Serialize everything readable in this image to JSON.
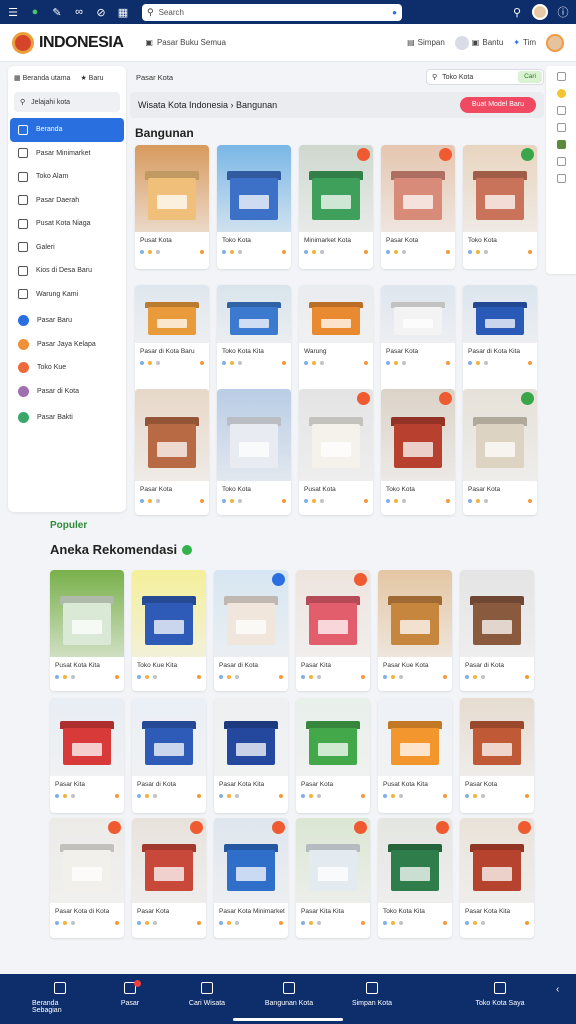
{
  "topbar": {
    "search_placeholder": "Search",
    "icons": [
      "menu-icon",
      "app-logo-icon",
      "edit-icon",
      "link-icon",
      "block-icon",
      "id-card-icon",
      "search-icon",
      "user-icon",
      "help-icon"
    ]
  },
  "header": {
    "brand": "INDONESIA",
    "nav_link": "Pasar Buku Semua",
    "items": [
      "Simpan",
      "Bantu",
      "Tim"
    ]
  },
  "sidebar": {
    "top_links": [
      "Beranda utama",
      "Baru"
    ],
    "search_label": "Jelajahi kota",
    "items": [
      {
        "label": "Beranda",
        "active": true,
        "kind": "icon"
      },
      {
        "label": "Pasar Minimarket",
        "active": false,
        "kind": "icon"
      },
      {
        "label": "Toko Alam",
        "active": false,
        "kind": "icon"
      },
      {
        "label": "Pasar Daerah",
        "active": false,
        "kind": "icon"
      },
      {
        "label": "Pusat Kota Niaga",
        "active": false,
        "kind": "icon"
      },
      {
        "label": "Galeri",
        "active": false,
        "kind": "icon"
      },
      {
        "label": "Kios di Desa Baru",
        "active": false,
        "kind": "icon"
      },
      {
        "label": "Warung Kami",
        "active": false,
        "kind": "icon"
      },
      {
        "label": "Pasar Baru",
        "active": false,
        "kind": "dot",
        "color": "#2a6fe0"
      },
      {
        "label": "Pasar Jaya Kelapa",
        "active": false,
        "kind": "dot",
        "color": "#f0913a"
      },
      {
        "label": "Toko Kue",
        "active": false,
        "kind": "dot",
        "color": "#ee6a3a"
      },
      {
        "label": "Pasar di Kota",
        "active": false,
        "kind": "dot",
        "color": "#a070b0"
      },
      {
        "label": "Pasar Bakti",
        "active": false,
        "kind": "dot",
        "color": "#3aa66a"
      }
    ]
  },
  "main": {
    "category_label": "Pasar Kota",
    "mini_search_placeholder": "Toko Kota",
    "mini_search_button": "Cari",
    "banner_text": "Wisata Kota Indonesia › Bangunan",
    "banner_cta": "Buat Model Baru",
    "section_title": "Bangunan"
  },
  "section1_cards": [
    {
      "title": "Pusat Kota",
      "bg": "#d89a5e",
      "bldg": "#f0c07a",
      "badge": ""
    },
    {
      "title": "Toko Kota",
      "bg": "#7ab7e6",
      "bldg": "#3d70c7",
      "badge": ""
    },
    {
      "title": "Minimarket Kota",
      "bg": "#cfd8cf",
      "bldg": "#3ea05a",
      "badge": "#ef5a30"
    },
    {
      "title": "Pasar Kota",
      "bg": "#e5c6b0",
      "bldg": "#d98b7a",
      "badge": "#ef5a30"
    },
    {
      "title": "Toko Kota",
      "bg": "#e8d5c0",
      "bldg": "#c9745a",
      "badge": "#3aa64a"
    },
    {
      "title": "Pasar di Kota Baru",
      "bg": "#dfe7ee",
      "bldg": "#e99a3a",
      "badge": ""
    },
    {
      "title": "Toko Kota Kita",
      "bg": "#d8e4ec",
      "bldg": "#3c7ad0",
      "badge": ""
    },
    {
      "title": "Warung",
      "bg": "#e9ecef",
      "bldg": "#e98a30",
      "badge": ""
    },
    {
      "title": "Pasar Kota",
      "bg": "#dfe6ef",
      "bldg": "#f3f3f3",
      "badge": ""
    },
    {
      "title": "Pasar di Kota Kita",
      "bg": "#dce5ee",
      "bldg": "#2a5ab8",
      "badge": ""
    },
    {
      "title": "Pasar Kota",
      "bg": "#e7d8c8",
      "bldg": "#b86a44",
      "badge": ""
    },
    {
      "title": "Toko Kota",
      "bg": "#b9cde6",
      "bldg": "#e8ecf2",
      "badge": ""
    },
    {
      "title": "Pusat Kota",
      "bg": "#e4e4e4",
      "bldg": "#f5f2ec",
      "badge": "#ef5a30"
    },
    {
      "title": "Toko Kota",
      "bg": "#dcd3c8",
      "bldg": "#b8402e",
      "badge": "#ef5a30"
    },
    {
      "title": "Pasar Kota",
      "bg": "#e6e1d8",
      "bldg": "#ddd3c2",
      "badge": "#3aa64a"
    }
  ],
  "section2": {
    "small_title": "Populer",
    "title": "Aneka Rekomendasi"
  },
  "section2_cards": [
    {
      "title": "Pusat Kota Kita",
      "bg": "#78b04a",
      "bldg": "#d9e9d5",
      "badge": ""
    },
    {
      "title": "Toko Kue Kita",
      "bg": "#f4ef9a",
      "bldg": "#2f5bb8",
      "badge": ""
    },
    {
      "title": "Pasar di Kota",
      "bg": "#d6e6f2",
      "bldg": "#f0e6dc",
      "badge": "#2a6fe0"
    },
    {
      "title": "Pasar Kita",
      "bg": "#eee4de",
      "bldg": "#e25e6c",
      "badge": "#ef5a30"
    },
    {
      "title": "Pasar Kue Kota",
      "bg": "#e4c6a4",
      "bldg": "#c7863e",
      "badge": ""
    },
    {
      "title": "Pasar di Kota",
      "bg": "#e4e4e4",
      "bldg": "#8a5a3e",
      "badge": ""
    },
    {
      "title": "Pasar Kita",
      "bg": "#e8eef4",
      "bldg": "#d83a3a",
      "badge": ""
    },
    {
      "title": "Pasar di Kota",
      "bg": "#eaf0f6",
      "bldg": "#2f5bb8",
      "badge": ""
    },
    {
      "title": "Pasar Kota Kita",
      "bg": "#eef0f2",
      "bldg": "#24489e",
      "badge": ""
    },
    {
      "title": "Pasar Kota",
      "bg": "#e8f0ea",
      "bldg": "#43a84a",
      "badge": ""
    },
    {
      "title": "Pusat Kota Kita",
      "bg": "#eef2f6",
      "bldg": "#f3962e",
      "badge": ""
    },
    {
      "title": "Pasar Kota",
      "bg": "#e6dcd0",
      "bldg": "#c05a36",
      "badge": ""
    },
    {
      "title": "Pasar Kota di Kota",
      "bg": "#ecebe8",
      "bldg": "#f2f0ea",
      "badge": "#ef5a30"
    },
    {
      "title": "Pasar Kota",
      "bg": "#e8e2dc",
      "bldg": "#c8493a",
      "badge": "#ef5a30"
    },
    {
      "title": "Pasar Kota Minimarket",
      "bg": "#dfe6ee",
      "bldg": "#2f6ec9",
      "badge": "#ef5a30"
    },
    {
      "title": "Pasar Kita Kita",
      "bg": "#dbe6d3",
      "bldg": "#e3eaf0",
      "badge": "#ef5a30"
    },
    {
      "title": "Toko Kota Kita",
      "bg": "#e4e6e2",
      "bldg": "#2e7d4a",
      "badge": "#ef5a30"
    },
    {
      "title": "Pasar Kota Kita",
      "bg": "#e9e2d9",
      "bldg": "#b5432e",
      "badge": "#ef5a30"
    }
  ],
  "bottom_nav": [
    {
      "label": "Beranda Sebagian",
      "icon": "store-icon"
    },
    {
      "label": "Pasar",
      "icon": "home-icon"
    },
    {
      "label": "Cari Wisata",
      "icon": "box-icon"
    },
    {
      "label": "Bangunan Kota",
      "icon": "map-icon"
    },
    {
      "label": "Simpan Kota",
      "icon": "folder-icon"
    },
    {
      "label": "Toko Kota Saya",
      "icon": "profile-icon"
    }
  ],
  "colors": {
    "navy": "#0d2d6b",
    "primary": "#2a6fe0",
    "cta": "#ef4a61",
    "green": "#31b24a"
  }
}
